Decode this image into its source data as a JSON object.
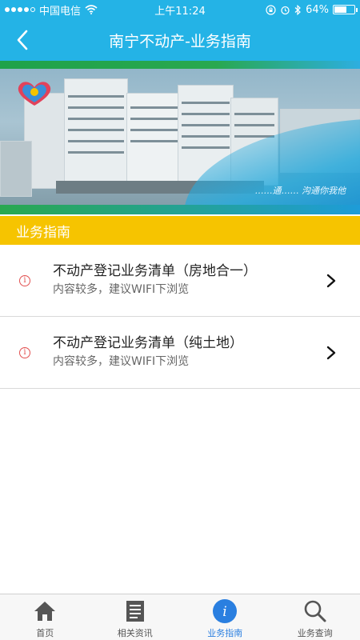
{
  "statusbar": {
    "carrier": "中国电信",
    "time": "上午11:24",
    "battery": "64%",
    "battery_level": 0.64
  },
  "navbar": {
    "title": "南宁不动产-业务指南"
  },
  "banner": {
    "caption": "……通…… 沟通你我他"
  },
  "section": {
    "title": "业务指南"
  },
  "items": [
    {
      "title": "不动产登记业务清单（房地合一）",
      "subtitle": "内容较多，建议WIFI下浏览"
    },
    {
      "title": "不动产登记业务清单（纯土地）",
      "subtitle": "内容较多，建议WIFI下浏览"
    }
  ],
  "tabs": [
    {
      "label": "首页",
      "icon": "home-icon",
      "active": false
    },
    {
      "label": "相关资讯",
      "icon": "news-icon",
      "active": false
    },
    {
      "label": "业务指南",
      "icon": "info-icon",
      "active": true
    },
    {
      "label": "业务查询",
      "icon": "search-icon",
      "active": false
    }
  ],
  "colors": {
    "primary": "#24b3e6",
    "section_bar": "#f6c400",
    "active_tab": "#2a7fe0",
    "info_red": "#e25050"
  }
}
